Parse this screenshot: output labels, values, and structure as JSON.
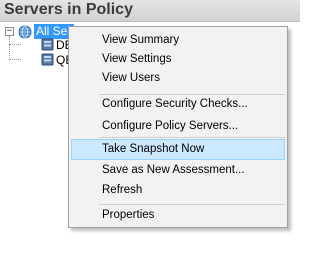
{
  "panel": {
    "title": "Servers in Policy"
  },
  "tree": {
    "expander": "−",
    "root_label": "All Servers",
    "children": [
      {
        "label": "DE"
      },
      {
        "label": "QE"
      }
    ]
  },
  "context_menu": {
    "view_summary": "View Summary",
    "view_settings": "View Settings",
    "view_users": "View Users",
    "configure_security_checks": "Configure Security Checks...",
    "configure_policy_servers": "Configure Policy Servers...",
    "take_snapshot_now": "Take Snapshot Now",
    "save_as_new_assessment": "Save as New Assessment...",
    "refresh": "Refresh",
    "properties": "Properties"
  },
  "colors": {
    "selection": "#3399ff",
    "menu_highlight": "#cce8ff",
    "menu_background": "#f2f2f2"
  },
  "icons": {
    "root": "globe-icon",
    "server": "server-icon",
    "expander": "collapse-icon"
  }
}
